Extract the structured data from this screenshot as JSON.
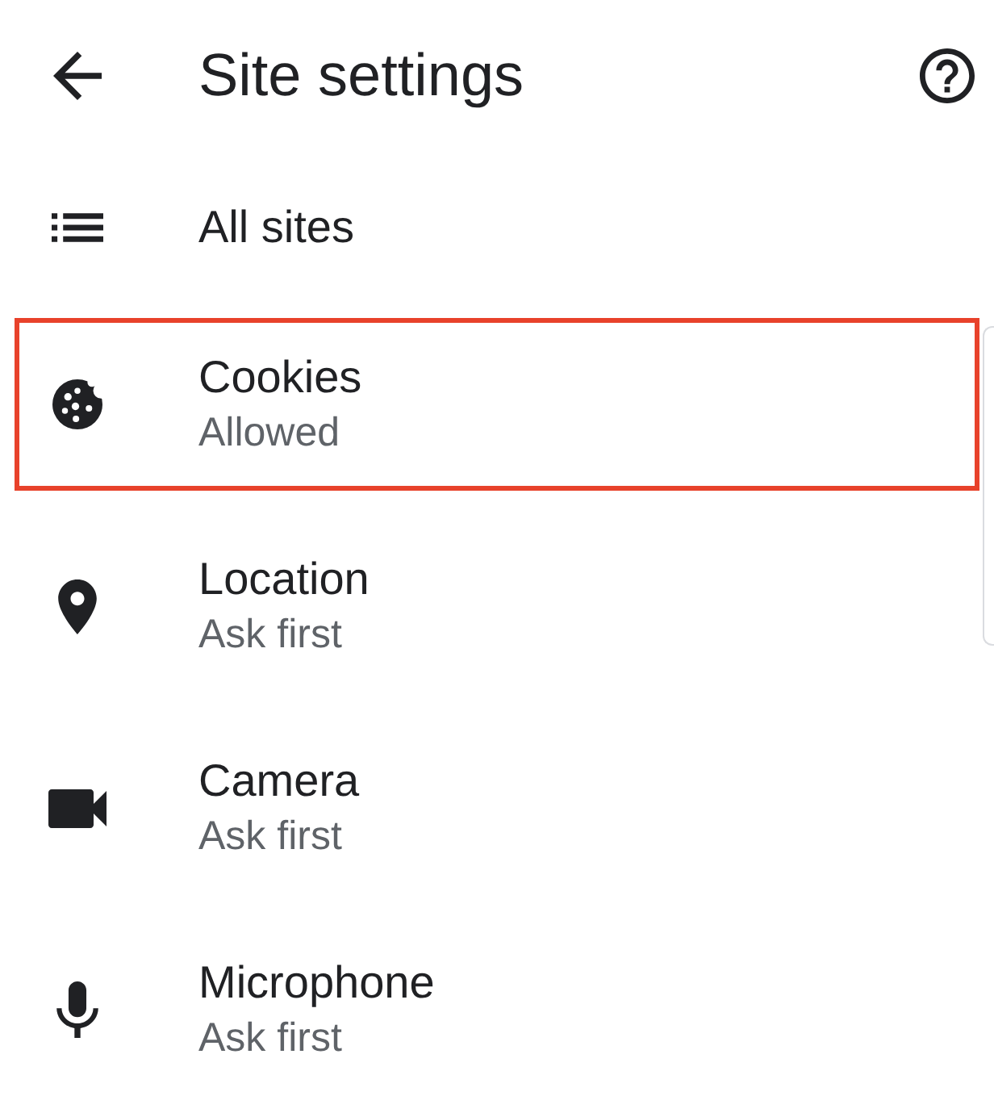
{
  "header": {
    "title": "Site settings"
  },
  "items": [
    {
      "label": "All sites",
      "highlighted": false
    },
    {
      "label": "Cookies",
      "status": "Allowed",
      "highlighted": true
    },
    {
      "label": "Location",
      "status": "Ask first",
      "highlighted": false
    },
    {
      "label": "Camera",
      "status": "Ask first",
      "highlighted": false
    },
    {
      "label": "Microphone",
      "status": "Ask first",
      "highlighted": false
    }
  ]
}
